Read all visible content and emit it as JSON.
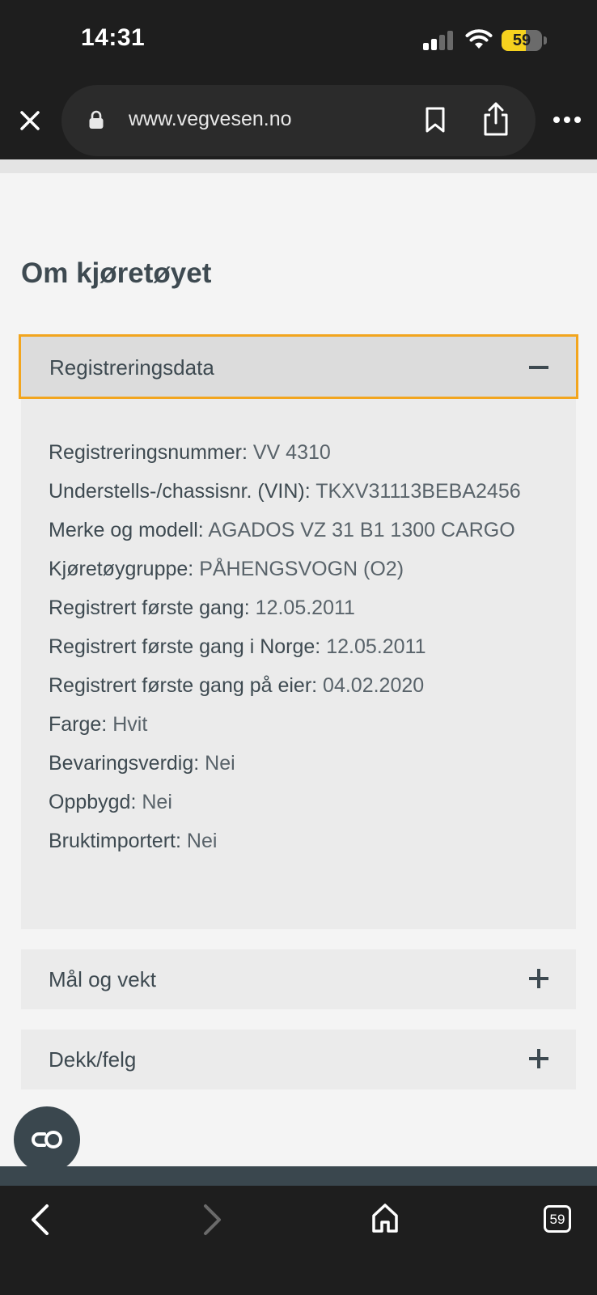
{
  "status_bar": {
    "time": "14:31",
    "battery_level": "59",
    "battery_fraction": 0.59,
    "signal_bars_active": 2,
    "signal_bars_total": 4
  },
  "browser": {
    "url": "www.vegvesen.no",
    "tab_count": "59"
  },
  "page": {
    "title": "Om kjøretøyet"
  },
  "accordion": {
    "registreringsdata": {
      "label": "Registreringsdata",
      "state": "expanded",
      "rows": [
        {
          "key": "Registreringsnummer:",
          "value": "VV 4310"
        },
        {
          "key": "Understells-/chassisnr. (VIN):",
          "value": "TKXV31113BEBA2456"
        },
        {
          "key": "Merke og modell:",
          "value": "AGADOS VZ 31 B1 1300 CARGO"
        },
        {
          "key": "Kjøretøygruppe:",
          "value": "PÅHENGSVOGN (O2)"
        },
        {
          "key": "Registrert første gang:",
          "value": "12.05.2011"
        },
        {
          "key": "Registrert første gang i Norge:",
          "value": "12.05.2011"
        },
        {
          "key": "Registrert første gang på eier:",
          "value": "04.02.2020"
        },
        {
          "key": "Farge:",
          "value": "Hvit"
        },
        {
          "key": "Bevaringsverdig:",
          "value": "Nei"
        },
        {
          "key": "Oppbygd:",
          "value": "Nei"
        },
        {
          "key": "Bruktimportert:",
          "value": "Nei"
        }
      ]
    },
    "maal_og_vekt": {
      "label": "Mål og vekt",
      "state": "collapsed"
    },
    "dekk_felg": {
      "label": "Dekk/felg",
      "state": "collapsed"
    }
  },
  "colors": {
    "focus_outline": "#f2a51e",
    "heading_text": "#3e4a51",
    "chrome_bg": "#1e1e1e",
    "battery_yellow": "#f6d21e"
  },
  "icons": {
    "close": "close-icon",
    "lock": "lock-icon",
    "bookmark": "bookmark-icon",
    "share": "share-icon",
    "more": "more-icon",
    "collapse": "minus-icon",
    "expand": "plus-icon",
    "cookie_consent": "cookie-consent-icon",
    "back": "back-arrow-icon",
    "forward": "forward-arrow-icon",
    "home": "home-icon",
    "tabs": "tabs-icon"
  }
}
